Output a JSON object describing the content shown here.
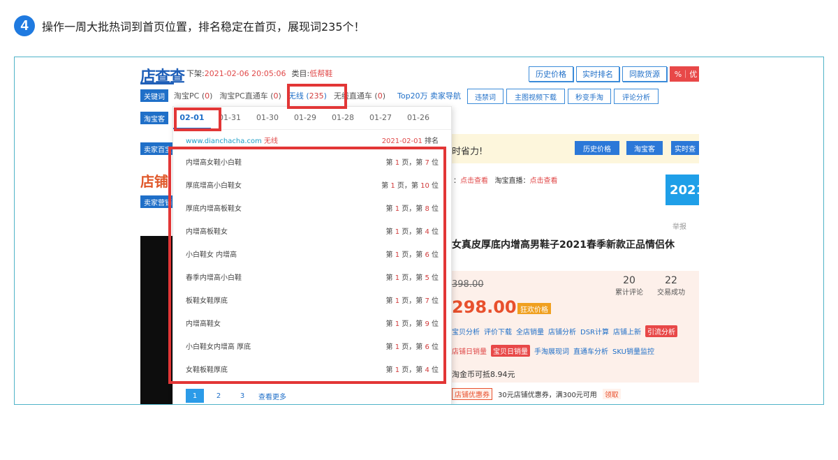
{
  "step": {
    "number": "4",
    "text": "操作一周大批热词到首页位置，排名稳定在首页，展现词235个！"
  },
  "header": {
    "logo_text": "店查查",
    "offline_label": "下架:",
    "offline_value": "2021-02-06 20:05:06",
    "category_label": "类目:",
    "category_value": "低帮鞋",
    "buttons": [
      "历史价格",
      "实时排名",
      "同款货源",
      "%｜优"
    ]
  },
  "side_tags": [
    "关键词",
    "淘宝客",
    "卖家百宝",
    "卖家营销"
  ],
  "keyword_row": {
    "items": [
      {
        "label": "淘宝PC",
        "count": "0"
      },
      {
        "label": "淘宝PC直通车",
        "count": "0"
      },
      {
        "label": "无线",
        "count": "235"
      },
      {
        "label": "无线直通车",
        "count": "0"
      }
    ],
    "top20": "Top20万 卖家导航",
    "tools": [
      "违禁词",
      "主图视频下载",
      "秒变手淘",
      "评论分析"
    ]
  },
  "dropdown": {
    "dates": [
      "02-01",
      "01-31",
      "01-30",
      "01-29",
      "01-28",
      "01-27",
      "01-26"
    ],
    "site": "www.dianchacha.com",
    "site_mode": "无线",
    "rank_date": "2021-02-01",
    "rank_label": "排名",
    "keywords": [
      {
        "kw": "内增高女鞋小白鞋",
        "page": "1",
        "pos": "7"
      },
      {
        "kw": "厚底增高小白鞋女",
        "page": "1",
        "pos": "10"
      },
      {
        "kw": "厚底内增高板鞋女",
        "page": "1",
        "pos": "8"
      },
      {
        "kw": "内增高板鞋女",
        "page": "1",
        "pos": "4"
      },
      {
        "kw": "小白鞋女 内增高",
        "page": "1",
        "pos": "6"
      },
      {
        "kw": "春季内增高小白鞋",
        "page": "1",
        "pos": "5"
      },
      {
        "kw": "板鞋女鞋厚底",
        "page": "1",
        "pos": "7"
      },
      {
        "kw": "内增高鞋女",
        "page": "1",
        "pos": "9"
      },
      {
        "kw": "小白鞋女内增高 厚底",
        "page": "1",
        "pos": "6"
      },
      {
        "kw": "女鞋板鞋厚底",
        "page": "1",
        "pos": "4"
      }
    ],
    "pages": [
      "1",
      "2",
      "3"
    ],
    "more": "查看更多"
  },
  "product": {
    "save_text": "时省力!",
    "bar_buttons": [
      "历史价格",
      "淘宝客",
      "实时查"
    ],
    "live_prefix": "：",
    "live_link1": "点击查看",
    "live_label": "淘宝直播：",
    "live_link2": "点击查看",
    "year_badge": "2021",
    "report": "举报",
    "title": "女真皮厚底内增高男鞋子2021春季新款正品情侣休",
    "old_price": "398.00",
    "new_price": "298.00",
    "promo": "狂欢价格",
    "comments_count": "20",
    "comments_label": "累计评论",
    "deals_count": "22",
    "deals_label": "交易成功",
    "tools1": [
      "宝贝分析",
      "评价下载",
      "全店销量",
      "店铺分析",
      "DSR计算",
      "店铺上新"
    ],
    "tools1_pill": "引流分析",
    "tools2_a": "店铺日销量",
    "tools2_pill": "宝贝日销量",
    "tools2": [
      "手淘展现词",
      "直通车分析",
      "SKU销量监控"
    ],
    "coin": "淘金币可抵8.94元",
    "coupon_tag": "店铺优惠券",
    "coupon_text": "30元店铺优惠券，满300元可用",
    "coupon_take": "领取"
  },
  "shop_fragment": "店铺"
}
